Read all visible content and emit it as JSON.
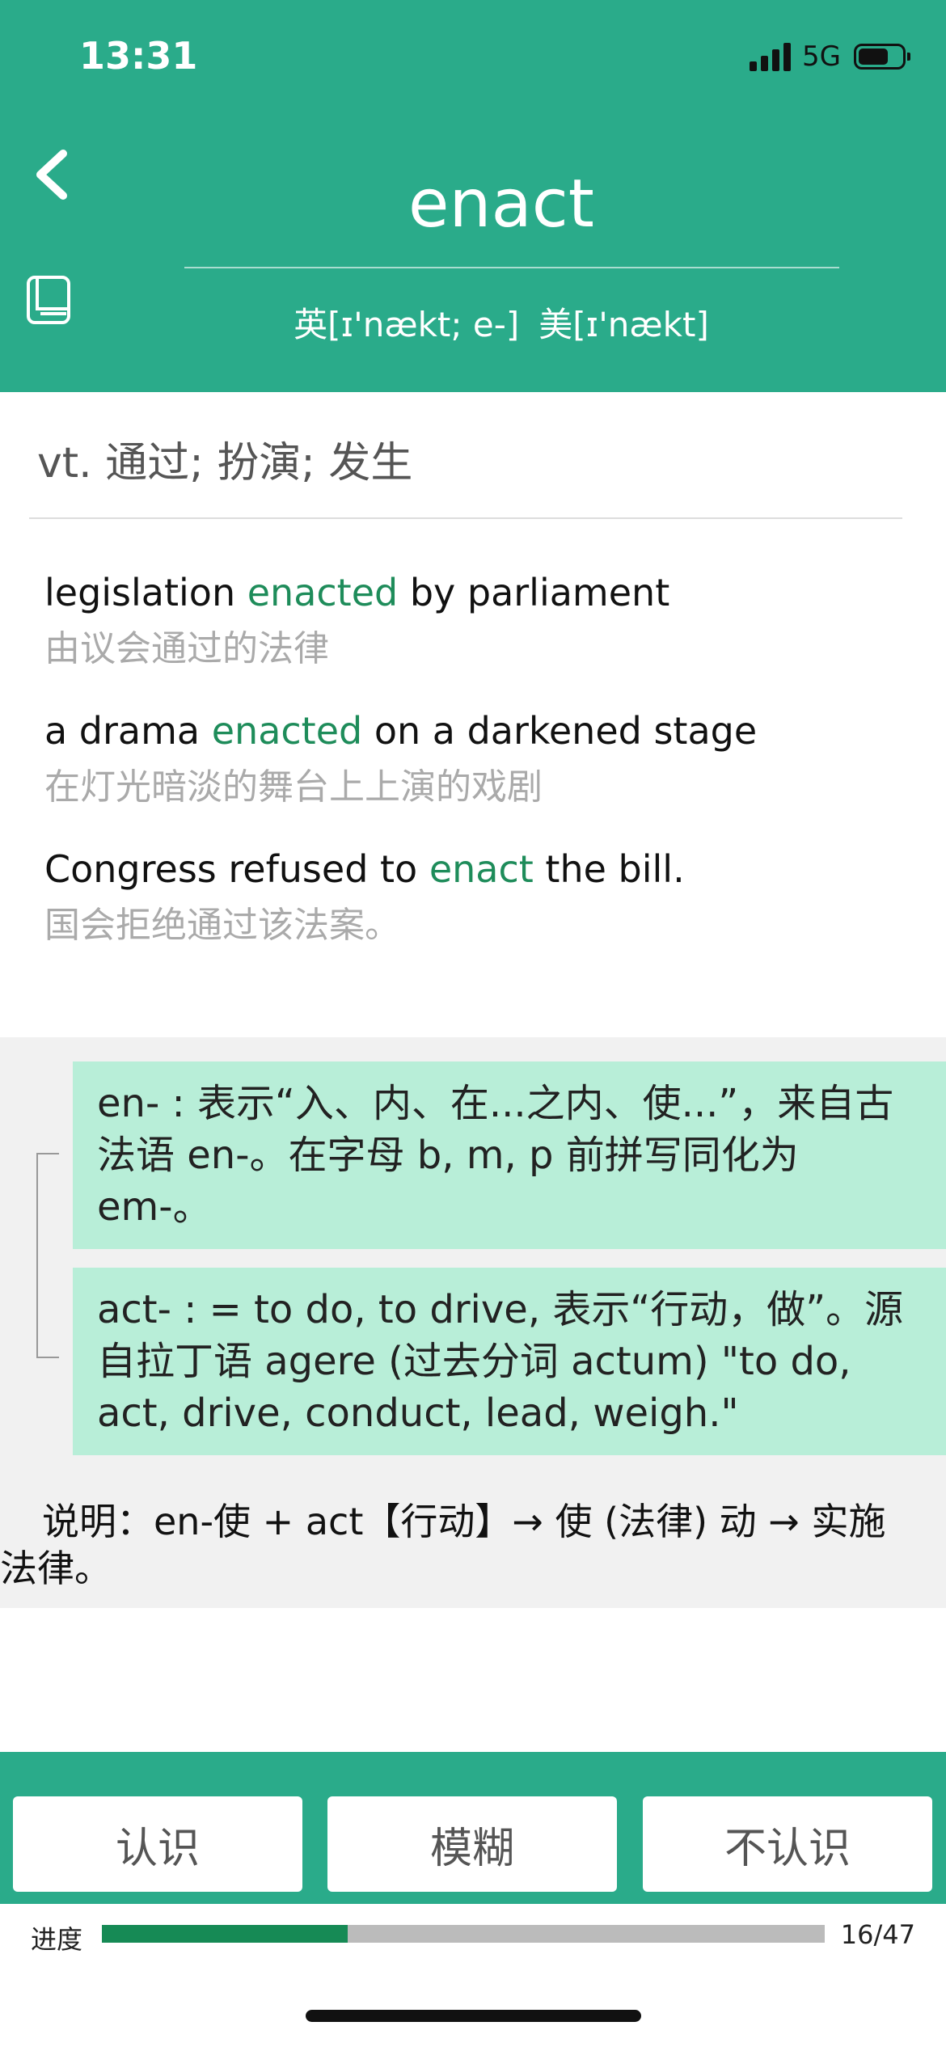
{
  "status_bar": {
    "time": "13:31",
    "network": "5G"
  },
  "header": {
    "word": "enact",
    "phonetic_uk": "英[ɪ'nækt; e-]",
    "phonetic_us": "美[ɪ'nækt]",
    "back_icon": "chevron-left-icon",
    "notebook_icon": "notebook-icon"
  },
  "definition": "vt. 通过; 扮演; 发生",
  "examples": [
    {
      "en_before": "legislation ",
      "en_highlight": "enacted",
      "en_after": " by parliament",
      "cn": "由议会通过的法律"
    },
    {
      "en_before": "a drama ",
      "en_highlight": "enacted",
      "en_after": " on a darkened stage",
      "cn": "在灯光暗淡的舞台上上演的戏剧"
    },
    {
      "en_before": "Congress refused to ",
      "en_highlight": "enact",
      "en_after": " the bill.",
      "cn": "国会拒绝通过该法案。"
    }
  ],
  "etymology": {
    "morphemes": [
      "en- : 表示“入、内、在...之内、使...”，来自古法语 en-。在字母 b, m, p 前拼写同化为 em-。",
      "act- : = to do, to drive, 表示“行动，做”。源自拉丁语 agere (过去分词 actum) \"to do, act, drive, conduct, lead, weigh.\""
    ],
    "explanation": "说明：en-使 + act【行动】→ 使 (法律) 动 → 实施法律。"
  },
  "actions": {
    "know": "认识",
    "fuzzy": "模糊",
    "unknown": "不认识"
  },
  "progress": {
    "label": "进度",
    "current": 16,
    "total": 47,
    "count_text": "16/47"
  },
  "colors": {
    "brand": "#2aab8a",
    "highlight": "#1e8c5a",
    "morph_bg": "#b8eed8",
    "progress_fill": "#168a55"
  }
}
